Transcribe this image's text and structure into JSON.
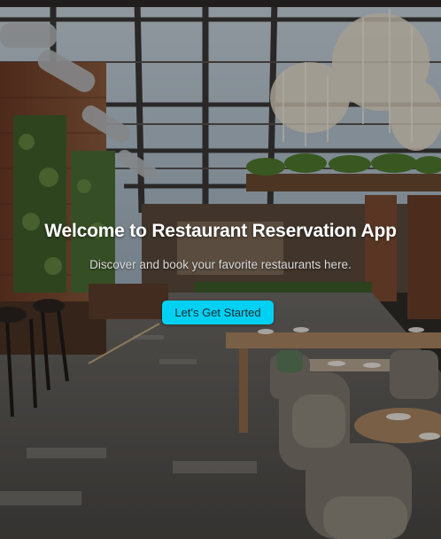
{
  "hero": {
    "title": "Welcome to Restaurant Reservation App",
    "subtitle": "Discover and book your favorite restaurants here.",
    "cta_label": "Let's Get Started"
  },
  "colors": {
    "cta_background": "#00d1f2",
    "title_text": "#ffffff",
    "subtitle_text": "#dcdcdc"
  }
}
